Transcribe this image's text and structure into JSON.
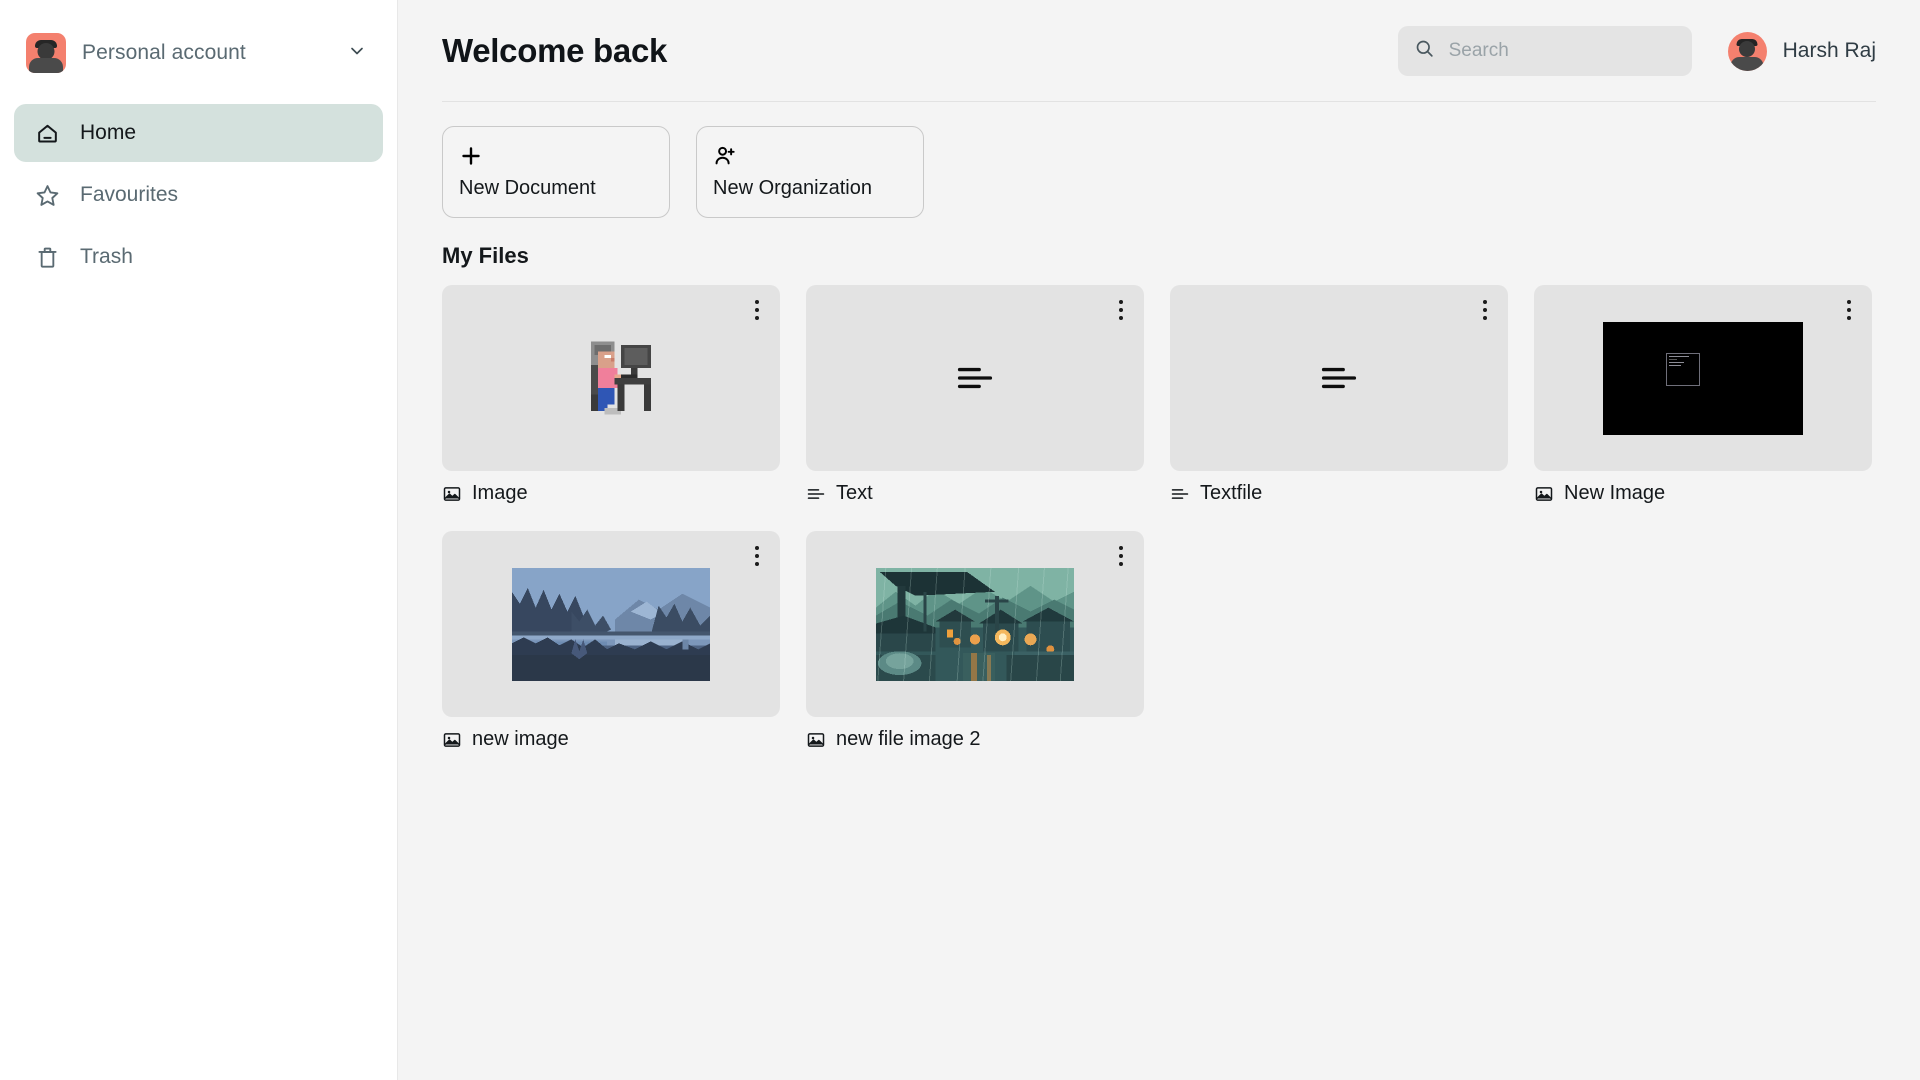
{
  "sidebar": {
    "account": {
      "label": "Personal account",
      "chevron_icon": "chevron-down-icon",
      "avatar_icon": "account-avatar"
    },
    "items": [
      {
        "label": "Home",
        "icon": "home-icon",
        "active": true
      },
      {
        "label": "Favourites",
        "icon": "star-icon",
        "active": false
      },
      {
        "label": "Trash",
        "icon": "trash-icon",
        "active": false
      }
    ]
  },
  "header": {
    "title": "Welcome back",
    "search": {
      "placeholder": "Search",
      "value": "",
      "icon": "search-icon"
    },
    "user": {
      "name": "Harsh Raj",
      "avatar_icon": "user-avatar"
    }
  },
  "actions": [
    {
      "label": "New Document",
      "icon": "plus-icon"
    },
    {
      "label": "New Organization",
      "icon": "user-plus-icon"
    }
  ],
  "files_section": {
    "title": "My Files",
    "menu_icon": "kebab-menu-icon",
    "items": [
      {
        "name": "Image",
        "type": "image",
        "thumb": "pixel-desk",
        "label_icon": "image-icon"
      },
      {
        "name": "Text",
        "type": "text",
        "thumb": "text-lines",
        "label_icon": "text-icon"
      },
      {
        "name": "Textfile",
        "type": "text",
        "thumb": "text-lines",
        "label_icon": "text-icon"
      },
      {
        "name": "New Image",
        "type": "image",
        "thumb": "black-screenshot",
        "label_icon": "image-icon"
      },
      {
        "name": "new image",
        "type": "image",
        "thumb": "lake-landscape",
        "label_icon": "image-icon"
      },
      {
        "name": "new file image 2",
        "type": "image",
        "thumb": "rainy-village",
        "label_icon": "image-icon"
      }
    ]
  },
  "colors": {
    "app_background": "#f4f4f4",
    "sidebar_background": "#ffffff",
    "active_nav": "#d4e1dd",
    "card_background": "#e3e3e3",
    "avatar_accent": "#f4806e",
    "search_background": "#e4e4e4",
    "text_primary": "#14181b",
    "text_muted": "#5a6a72"
  }
}
